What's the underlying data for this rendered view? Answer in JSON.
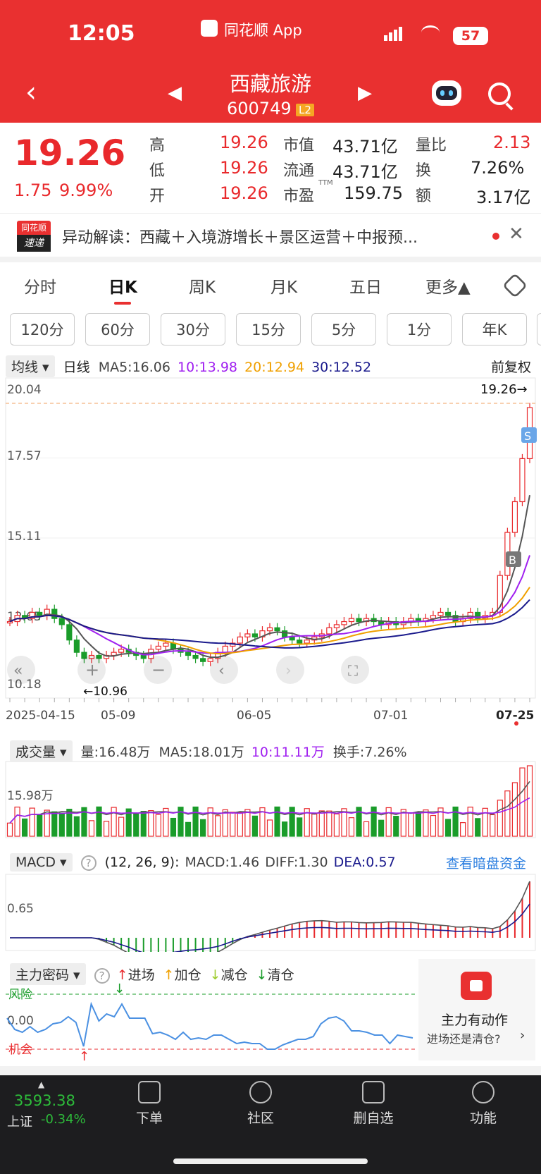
{
  "status_bar": {
    "time": "12:05",
    "app_name": "同花顺 App",
    "battery": "57"
  },
  "header": {
    "back_icon": "chevron-left-icon",
    "prev_icon": "triangle-left-icon",
    "next_icon": "triangle-right-icon",
    "stock_name": "西藏旅游",
    "stock_code": "600749",
    "level_badge": "L2",
    "robot_icon": "robot-icon",
    "search_icon": "search-icon"
  },
  "quote": {
    "price": "19.26",
    "change": "1.75",
    "change_pct": "9.99%",
    "fields": [
      {
        "label": "高",
        "value": "19.26",
        "color": "red"
      },
      {
        "label": "低",
        "value": "19.26",
        "color": "red"
      },
      {
        "label": "开",
        "value": "19.26",
        "color": "red"
      },
      {
        "label": "市值",
        "value": "43.71亿"
      },
      {
        "label": "流通",
        "value": "43.71亿"
      },
      {
        "label": "市盈",
        "sup": "TTM",
        "value": "159.75"
      },
      {
        "label": "量比",
        "value": "2.13",
        "color": "red"
      },
      {
        "label": "换",
        "value": "7.26%"
      },
      {
        "label": "额",
        "value": "3.17亿"
      }
    ]
  },
  "news": {
    "logo_top": "同花顺",
    "logo_bottom": "速递",
    "text": "异动解读：西藏＋入境游增长＋景区运营＋中报预...",
    "close_icon": "close-icon"
  },
  "tabs": [
    {
      "label": "分时"
    },
    {
      "label": "日K",
      "active": true
    },
    {
      "label": "周K"
    },
    {
      "label": "月K"
    },
    {
      "label": "五日"
    },
    {
      "label": "更多▲"
    }
  ],
  "settings_icon": "hexagon-settings-icon",
  "subtabs": [
    "120分",
    "60分",
    "30分",
    "15分",
    "5分",
    "1分",
    "年K"
  ],
  "kline": {
    "indicator_dropdown": "均线",
    "period": "日线",
    "ma5": "MA5:16.06",
    "ma10": "10:13.98",
    "ma20": "20:12.94",
    "ma30": "30:12.52",
    "adjust": "前复权",
    "y_labels": [
      "20.04",
      "17.57",
      "15.11",
      "12.65",
      "10.18"
    ],
    "last_price_label": "19.26→",
    "low_label": "←10.96",
    "x_labels": [
      "2025-04-15",
      "05-09",
      "06-05",
      "07-01",
      "07-25"
    ],
    "buy_marker": "B",
    "sell_marker": "S",
    "colors": {
      "ma5": "#555555",
      "ma10": "#a020f0",
      "ma20": "#f0a000",
      "ma30": "#1a1a8c",
      "up": "#e9292c",
      "down": "#1a9c2a"
    }
  },
  "volume": {
    "dropdown": "成交量",
    "vol": "量:16.48万",
    "ma5": "MA5:18.01万",
    "ma10": "10:11.11万",
    "turnover": "换手:7.26%",
    "y_label": "15.98万"
  },
  "macd": {
    "dropdown": "MACD",
    "help_icon": "question-circle-icon",
    "params": "(12, 26, 9):",
    "macd": "MACD:1.46",
    "diff": "DIFF:1.30",
    "dea": "DEA:0.57",
    "link": "查看暗盘资金",
    "y_label": "0.65"
  },
  "zhuli": {
    "dropdown": "主力密码",
    "help_icon": "question-circle-icon",
    "legend": [
      {
        "label": "进场",
        "color": "#e9292c"
      },
      {
        "label": "加仓",
        "color": "#f0a000"
      },
      {
        "label": "减仓",
        "color": "#9ccc2a"
      },
      {
        "label": "清仓",
        "color": "#1a9c2a"
      }
    ],
    "risk_label": "风险",
    "zero_label": "0.00",
    "chance_label": "机会",
    "promo_icon": "lock-icon",
    "promo_title": "主力有动作",
    "promo_sub": "进场还是清仓?"
  },
  "bottom_nav": {
    "index_value": "3593.38",
    "index_name": "上证",
    "index_change": "-0.34%",
    "items": [
      {
        "label": "下单",
        "icon": "order-icon"
      },
      {
        "label": "社区",
        "icon": "community-icon"
      },
      {
        "label": "删自选",
        "icon": "remove-watchlist-icon"
      },
      {
        "label": "功能",
        "icon": "menu-icon"
      }
    ]
  },
  "chart_data": [
    {
      "type": "candlestick",
      "title": "日K",
      "x": [
        "2025-04-15",
        "05-09",
        "06-05",
        "07-01",
        "07-25"
      ],
      "ylim": [
        10.18,
        20.04
      ],
      "series": [
        {
          "name": "MA5",
          "last": 16.06
        },
        {
          "name": "MA10",
          "last": 13.98
        },
        {
          "name": "MA20",
          "last": 12.94
        },
        {
          "name": "MA30",
          "last": 12.52
        }
      ],
      "closes": [
        12.3,
        12.5,
        12.4,
        12.6,
        12.5,
        12.7,
        12.4,
        12.2,
        11.7,
        11.3,
        11.1,
        11.2,
        11.1,
        11.2,
        11.3,
        11.4,
        11.3,
        11.2,
        11.1,
        11.4,
        11.5,
        11.6,
        11.4,
        11.3,
        11.2,
        11.1,
        11.0,
        11.1,
        11.3,
        11.5,
        11.6,
        11.8,
        11.9,
        11.8,
        12.0,
        12.1,
        12.0,
        11.8,
        11.7,
        11.6,
        11.7,
        11.8,
        11.9,
        12.1,
        12.2,
        12.3,
        12.4,
        12.3,
        12.4,
        12.3,
        12.2,
        12.3,
        12.2,
        12.3,
        12.4,
        12.3,
        12.4,
        12.5,
        12.6,
        12.5,
        12.3,
        12.4,
        12.6,
        12.4,
        12.5,
        12.6,
        13.8,
        15.2,
        16.2,
        17.6,
        19.26
      ]
    },
    {
      "type": "bar",
      "title": "成交量",
      "ylabel": "15.98万"
    },
    {
      "type": "bar",
      "title": "MACD",
      "params": "(12, 26, 9)",
      "macd": 1.46,
      "diff": 1.3,
      "dea": 0.57
    },
    {
      "type": "line",
      "title": "主力密码"
    }
  ]
}
